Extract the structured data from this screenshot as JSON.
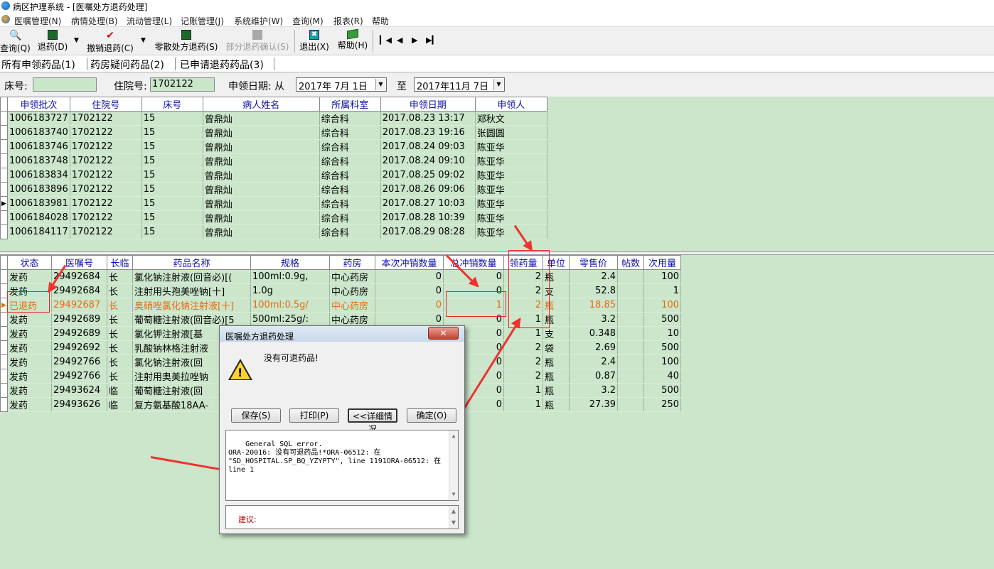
{
  "window": {
    "title": "病区护理系统 - [医嘱处方退药处理]"
  },
  "menu": [
    "医嘱管理(N)",
    "病情处理(B)",
    "流动管理(L)",
    "记账管理(J)",
    "系统维护(W)",
    "查询(M)",
    "报表(R)",
    "帮助"
  ],
  "toolbar": {
    "query": "查询(Q)",
    "return": "退药(D)",
    "cancel_return": "撤销退药(C)",
    "loose_return": "零散处方退药(S)",
    "partial_confirm": "部分退药确认(S)",
    "exit": "退出(X)",
    "help": "帮助(H)"
  },
  "tabs": [
    "所有申领药品(1)",
    "药房疑问药品(2)",
    "已申请退药药品(3)"
  ],
  "filter": {
    "bed_label": "床号:",
    "bed_value": "",
    "inpatient_label": "住院号:",
    "inpatient_value": "1702122",
    "date_label": "申领日期: 从",
    "date_from": "2017年 7月 1日",
    "to_label": "至",
    "date_to": "2017年11月 7日"
  },
  "upper_grid": {
    "headers": [
      "申领批次",
      "住院号",
      "床号",
      "病人姓名",
      "所属科室",
      "申领日期",
      "申领人"
    ],
    "rows": [
      [
        "1006183727",
        "1702122",
        "15",
        "曾鼎灿",
        "综合科",
        "2017.08.23 13:17",
        "郑秋文"
      ],
      [
        "1006183740",
        "1702122",
        "15",
        "曾鼎灿",
        "综合科",
        "2017.08.23 19:16",
        "张圆圆"
      ],
      [
        "1006183746",
        "1702122",
        "15",
        "曾鼎灿",
        "综合科",
        "2017.08.24 09:03",
        "陈亚华"
      ],
      [
        "1006183748",
        "1702122",
        "15",
        "曾鼎灿",
        "综合科",
        "2017.08.24 09:10",
        "陈亚华"
      ],
      [
        "1006183834",
        "1702122",
        "15",
        "曾鼎灿",
        "综合科",
        "2017.08.25 09:02",
        "陈亚华"
      ],
      [
        "1006183896",
        "1702122",
        "15",
        "曾鼎灿",
        "综合科",
        "2017.08.26 09:06",
        "陈亚华"
      ],
      [
        "1006183981",
        "1702122",
        "15",
        "曾鼎灿",
        "综合科",
        "2017.08.27 10:03",
        "陈亚华"
      ],
      [
        "1006184028",
        "1702122",
        "15",
        "曾鼎灿",
        "综合科",
        "2017.08.28 10:39",
        "陈亚华"
      ],
      [
        "1006184117",
        "1702122",
        "15",
        "曾鼎灿",
        "综合科",
        "2017.08.29 08:28",
        "陈亚华"
      ]
    ],
    "current_row": 6
  },
  "lower_grid": {
    "headers": [
      "状态",
      "医嘱号",
      "长临",
      "药品名称",
      "规格",
      "药房",
      "本次冲销数量",
      "总冲销数量",
      "领药量",
      "单位",
      "零售价",
      "帖数",
      "次用量"
    ],
    "rows": [
      [
        "发药",
        "29492684",
        "长",
        "氯化钠注射液(回音必)[(",
        "100ml:0.9g,",
        "中心药房",
        "0",
        "0",
        "2",
        "瓶",
        "2.4",
        "",
        "100"
      ],
      [
        "发药",
        "29492684",
        "长",
        "注射用头孢美唑钠[十]",
        "1.0g",
        "中心药房",
        "0",
        "0",
        "2",
        "支",
        "52.8",
        "",
        "1"
      ],
      [
        "已退药",
        "29492687",
        "长",
        "奥硝唑氯化钠注射液[十]",
        "100ml:0.5g/",
        "中心药房",
        "0",
        "1",
        "2",
        "瓶",
        "18.85",
        "",
        "100"
      ],
      [
        "发药",
        "29492689",
        "长",
        "葡萄糖注射液(回音必)[5",
        "500ml:25g/:",
        "中心药房",
        "0",
        "0",
        "1",
        "瓶",
        "3.2",
        "",
        "500"
      ],
      [
        "发药",
        "29492689",
        "长",
        "氯化钾注射液[基",
        "",
        "",
        "",
        "0",
        "1",
        "支",
        "0.348",
        "",
        "10"
      ],
      [
        "发药",
        "29492692",
        "长",
        "乳酸钠林格注射液",
        "",
        "",
        "",
        "0",
        "2",
        "袋",
        "2.69",
        "",
        "500"
      ],
      [
        "发药",
        "29492766",
        "长",
        "氯化钠注射液(回",
        "",
        "",
        "",
        "0",
        "2",
        "瓶",
        "2.4",
        "",
        "100"
      ],
      [
        "发药",
        "29492766",
        "长",
        "注射用奥美拉唑钠",
        "",
        "",
        "",
        "0",
        "2",
        "瓶",
        "0.87",
        "",
        "40"
      ],
      [
        "发药",
        "29493624",
        "临",
        "葡萄糖注射液(回",
        "",
        "",
        "",
        "0",
        "1",
        "瓶",
        "3.2",
        "",
        "500"
      ],
      [
        "发药",
        "29493626",
        "临",
        "复方氨基酸18AA-",
        "",
        "",
        "",
        "0",
        "1",
        "瓶",
        "27.39",
        "",
        "250"
      ]
    ],
    "current_row": 2,
    "highlight_row": 2
  },
  "dialog": {
    "title": "医嘱处方退药处理",
    "message": "没有可退药品!",
    "buttons": {
      "save": "保存(S)",
      "print": "打印(P)",
      "details": "<<详细情况",
      "ok": "确定(O)"
    },
    "error_text": "General SQL error.\nORA-20016: 没有可退药品!*ORA-06512: 在\n\"SD_HOSPITAL.SP_BQ_YZYPTY\", line 1191ORA-06512: 在\nline 1",
    "suggest_label": "建议:"
  },
  "colors": {
    "grid_bg": "#cbe6cb",
    "header_text": "#1010b0",
    "highlight_text": "#e86a10",
    "annotation": "#e8262a"
  }
}
